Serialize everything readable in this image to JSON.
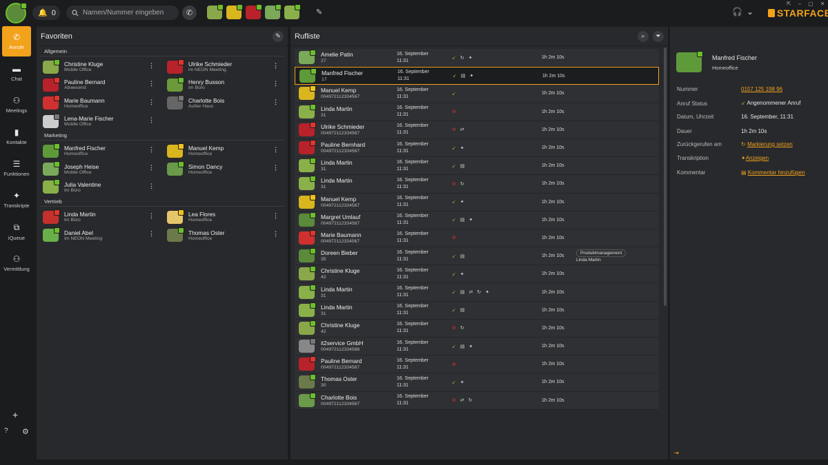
{
  "topbar": {
    "notif_count": "0",
    "search_placeholder": "Namen/Nummer eingeben",
    "brand": "STARFACE"
  },
  "colors": {
    "accent": "#f2a21b",
    "available": "#6cbf2a",
    "busy": "#e0362d"
  },
  "sidebar": {
    "items": [
      {
        "label": "Anrufe",
        "icon": "phone-icon"
      },
      {
        "label": "Chat",
        "icon": "chat-icon"
      },
      {
        "label": "Meetings",
        "icon": "meetings-icon"
      },
      {
        "label": "Kontakte",
        "icon": "contacts-icon"
      },
      {
        "label": "Funktionen",
        "icon": "functions-icon"
      },
      {
        "label": "Transkripte",
        "icon": "transcripts-icon"
      },
      {
        "label": "iQueue",
        "icon": "iqueue-icon"
      },
      {
        "label": "Vermittlung",
        "icon": "switchboard-icon"
      }
    ]
  },
  "favorites": {
    "title": "Favoriten",
    "groups": [
      {
        "name": "Allgemein",
        "contacts": [
          {
            "name": "Christine Kluge",
            "status": "Mobile Office",
            "c": "#8aa84a",
            "s": "green"
          },
          {
            "name": "Ulrike Schmieder",
            "status": "im NEON Meeting",
            "c": "#b8222b",
            "s": "red"
          },
          {
            "name": "Pauline Bernard",
            "status": "Abwesend",
            "c": "#b8222b",
            "s": "red"
          },
          {
            "name": "Henry Busson",
            "status": "Im Büro",
            "c": "#6a9a3a",
            "s": "green"
          },
          {
            "name": "Marie Baumann",
            "status": "Homeoffice",
            "c": "#d03030",
            "s": "red"
          },
          {
            "name": "Charlotte Bois",
            "status": "Außer Haus",
            "c": "#666",
            "s": "grey"
          },
          {
            "name": "Lena-Marie Fischer",
            "status": "Mobile Office",
            "c": "#cccccc",
            "s": "grey"
          }
        ]
      },
      {
        "name": "Marketing",
        "contacts": [
          {
            "name": "Manfred Fischer",
            "status": "Homeoffice",
            "c": "#5f9a3a",
            "s": "green"
          },
          {
            "name": "Manuel Kemp",
            "status": "Homeoffice",
            "c": "#d9b51e",
            "s": "yellow"
          },
          {
            "name": "Joseph Heise",
            "status": "Mobile Office",
            "c": "#7aa95a",
            "s": "green"
          },
          {
            "name": "Simon Dancy",
            "status": "Homeoffice",
            "c": "#6a9a4a",
            "s": "green"
          },
          {
            "name": "Julia Valentine",
            "status": "Im Büro",
            "c": "#8ab04a",
            "s": "green"
          }
        ]
      },
      {
        "name": "Vertrieb",
        "contacts": [
          {
            "name": "Linda Martin",
            "status": "Im Büro",
            "c": "#c4302b",
            "s": "red"
          },
          {
            "name": "Lea Flores",
            "status": "Homeoffice",
            "c": "#e6c66a",
            "s": "yellow"
          },
          {
            "name": "Daniel Abel",
            "status": "Im NEON Meeting",
            "c": "#6ab04a",
            "s": "green"
          },
          {
            "name": "Thomas Oster",
            "status": "Homeoffice",
            "c": "#6b7a4a",
            "s": "green"
          }
        ]
      }
    ]
  },
  "calllist": {
    "title": "Rufliste",
    "date": "16. September",
    "time": "11:31",
    "duration": "1h 2m 10s",
    "tag": "Produktmanagement",
    "tag_person": "Linda Martin",
    "rows": [
      {
        "name": "Amelie Patin",
        "sub": "27",
        "icons": [
          "in",
          "forward",
          "ai"
        ],
        "c": "#7aa95a",
        "s": "green"
      },
      {
        "name": "Manfred Fischer",
        "sub": "17",
        "icons": [
          "in",
          "note",
          "ai"
        ],
        "c": "#5f9a3a",
        "s": "green",
        "sel": true
      },
      {
        "name": "Manuel Kemp",
        "sub": "004972112334567",
        "icons": [
          "in"
        ],
        "c": "#d9b51e",
        "s": "yellow"
      },
      {
        "name": "Linda Martin",
        "sub": "31",
        "icons": [
          "miss"
        ],
        "c": "#8ab04a",
        "s": "green"
      },
      {
        "name": "Ulrike Schmieder",
        "sub": "004972112334567",
        "icons": [
          "miss",
          "transfer"
        ],
        "c": "#b8222b",
        "s": "red"
      },
      {
        "name": "Pauline Bernhard",
        "sub": "004972112334567",
        "icons": [
          "in",
          "ai"
        ],
        "c": "#b8222b",
        "s": "red"
      },
      {
        "name": "Linda Martin",
        "sub": "31",
        "icons": [
          "in",
          "note"
        ],
        "c": "#8ab04a",
        "s": "green"
      },
      {
        "name": "Linda Martin",
        "sub": "31",
        "icons": [
          "miss",
          "forward"
        ],
        "c": "#8ab04a",
        "s": "green"
      },
      {
        "name": "Manuel Kemp",
        "sub": "004972112334567",
        "icons": [
          "in",
          "ai"
        ],
        "c": "#d9b51e",
        "s": "yellow"
      },
      {
        "name": "Margret Umlauf",
        "sub": "004972112334567",
        "icons": [
          "in",
          "note",
          "ai"
        ],
        "c": "#5a8a3a",
        "s": "green"
      },
      {
        "name": "Marie Baumann",
        "sub": "004972112334567",
        "icons": [
          "miss"
        ],
        "c": "#d03030",
        "s": "red"
      },
      {
        "name": "Doreen Bieber",
        "sub": "35",
        "icons": [
          "in",
          "note"
        ],
        "c": "#5a8a3a",
        "s": "green",
        "tag": true
      },
      {
        "name": "Christine Kluge",
        "sub": "42",
        "icons": [
          "in",
          "ai"
        ],
        "c": "#8aa84a",
        "s": "green"
      },
      {
        "name": "Linda Martin",
        "sub": "31",
        "icons": [
          "in",
          "note",
          "transfer",
          "forward",
          "ai"
        ],
        "c": "#8ab04a",
        "s": "green"
      },
      {
        "name": "Linda Martin",
        "sub": "31",
        "icons": [
          "in",
          "note"
        ],
        "c": "#8ab04a",
        "s": "green"
      },
      {
        "name": "Christine Kluge",
        "sub": "42",
        "icons": [
          "miss",
          "forward"
        ],
        "c": "#8aa84a",
        "s": "green"
      },
      {
        "name": "it2service GmbH",
        "sub": "004972112334588",
        "icons": [
          "in",
          "note",
          "ai"
        ],
        "c": "#888888",
        "s": "grey"
      },
      {
        "name": "Pauline Bernard",
        "sub": "004972112334567",
        "icons": [
          "miss"
        ],
        "c": "#b8222b",
        "s": "red"
      },
      {
        "name": "Thomas Oster",
        "sub": "30",
        "icons": [
          "in",
          "ai"
        ],
        "c": "#6b7a4a",
        "s": "green"
      },
      {
        "name": "Charlotte Bois",
        "sub": "004972112334567",
        "icons": [
          "miss",
          "transfer",
          "forward"
        ],
        "c": "#6a9a4a",
        "s": "green"
      }
    ]
  },
  "detail": {
    "name": "Manfred Fischer",
    "status": "Homeoffice",
    "labels": {
      "number": "Nummer",
      "call_status": "Anruf Status",
      "datetime": "Datum, Uhrzeit",
      "duration": "Dauer",
      "callback": "Zurückgerufen am",
      "transcript": "Transkription",
      "comment": "Kommentar"
    },
    "values": {
      "number": "0157 125 198 96",
      "call_status": "Angenommener Anruf",
      "datetime": "16. September, 11:31",
      "duration": "1h 2m 10s",
      "callback": "Markierung setzen",
      "transcript": "Anzeigen",
      "comment": "Kommentar hinzufügen"
    }
  }
}
